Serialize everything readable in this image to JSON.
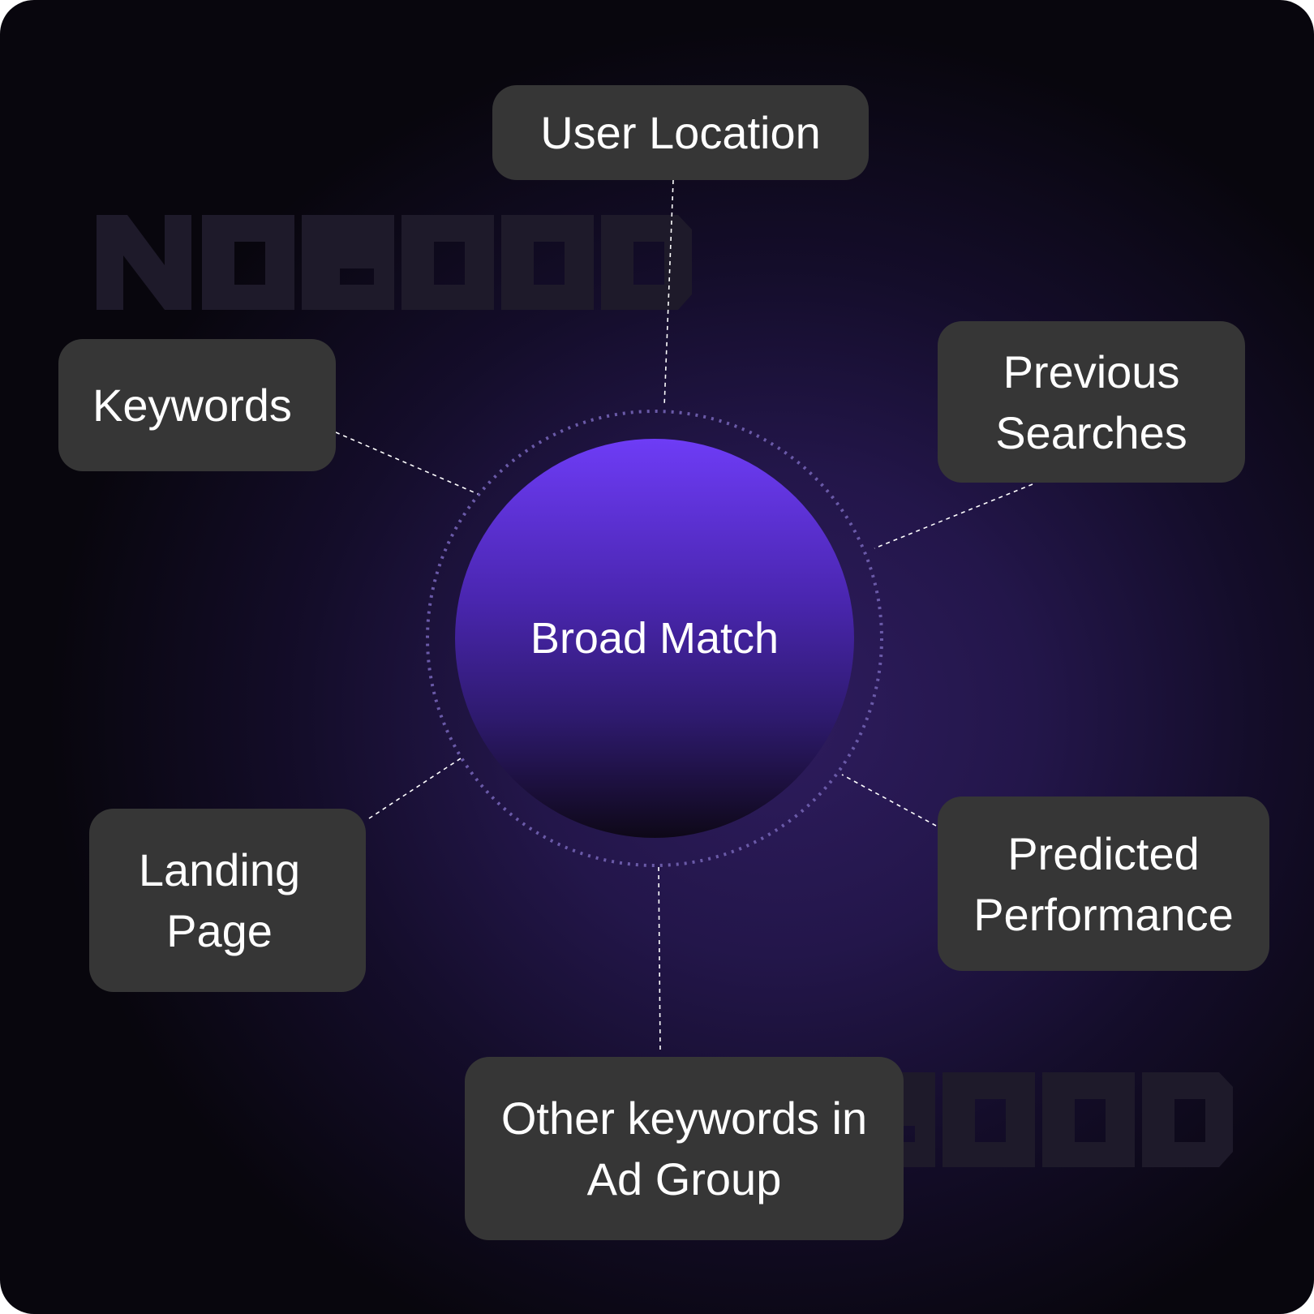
{
  "watermark": {
    "text": "NOGOOD"
  },
  "center": {
    "label": "Broad Match"
  },
  "nodes": {
    "user_location": "User Location",
    "keywords": "Keywords",
    "previous_searches_1": "Previous",
    "previous_searches_2": "Searches",
    "landing_page_1": "Landing",
    "landing_page_2": "Page",
    "predicted_performance_1": "Predicted",
    "predicted_performance_2": "Performance",
    "other_keywords_1": "Other keywords in",
    "other_keywords_2": "Ad Group"
  },
  "colors": {
    "node_bg": "#363636",
    "accent": "#6e3cf6",
    "background": "#140d2a"
  }
}
